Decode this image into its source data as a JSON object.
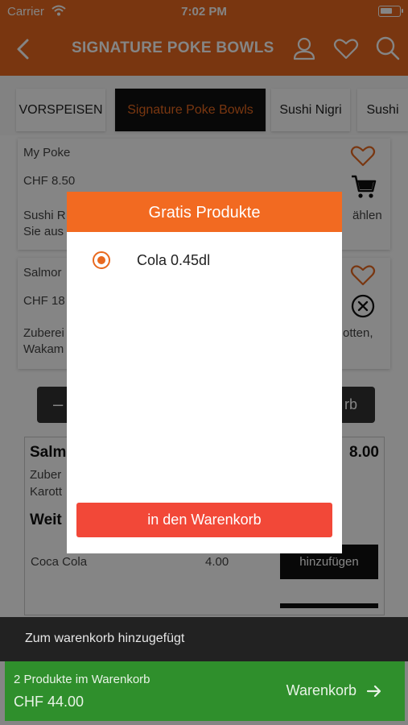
{
  "status_bar": {
    "carrier": "Carrier",
    "time": "7:02 PM"
  },
  "nav": {
    "title": "SIGNATURE POKE BOWLS"
  },
  "tabs": [
    {
      "label": "VORSPEISEN",
      "active": false
    },
    {
      "label": "Signature Poke Bowls",
      "active": true
    },
    {
      "label": "Sushi Nigri",
      "active": false
    },
    {
      "label": "Sushi",
      "active": false
    }
  ],
  "products": [
    {
      "name": "My Poke",
      "price": "CHF 8.50",
      "desc_line1": "Sushi R",
      "desc_line2": "Sie aus",
      "desc_right": "ählen"
    },
    {
      "name": "Salmor",
      "price": "CHF 18",
      "desc_line1": "Zuberei",
      "desc_line2": "Wakam",
      "desc_right": "otten,"
    }
  ],
  "quantity_button": {
    "minus": "–",
    "right_text": "rb"
  },
  "detail": {
    "title_left": "Salm",
    "price_right": "8.00",
    "line1_left": "Zuber",
    "line1_right": "",
    "line2": "Karott",
    "extras_heading": "Weit",
    "extra_item": {
      "name": "Coca Cola",
      "price": "4.00",
      "button": "hinzufügen"
    }
  },
  "dialog": {
    "title": "Gratis Produkte",
    "option_label": "Cola 0.45dl",
    "option_selected": true,
    "submit_label": "in den Warenkorb"
  },
  "toast": {
    "message": "Zum warenkorb hinzugefügt"
  },
  "cart_bar": {
    "count_text": "2 Produkte im Warenkorb",
    "total_text": "CHF 44.00",
    "link_label": "Warenkorb"
  },
  "colors": {
    "brand_orange": "#e8691f",
    "dialog_header": "#f26a21",
    "submit_red": "#f24838",
    "cart_green": "#2f8f2c"
  }
}
